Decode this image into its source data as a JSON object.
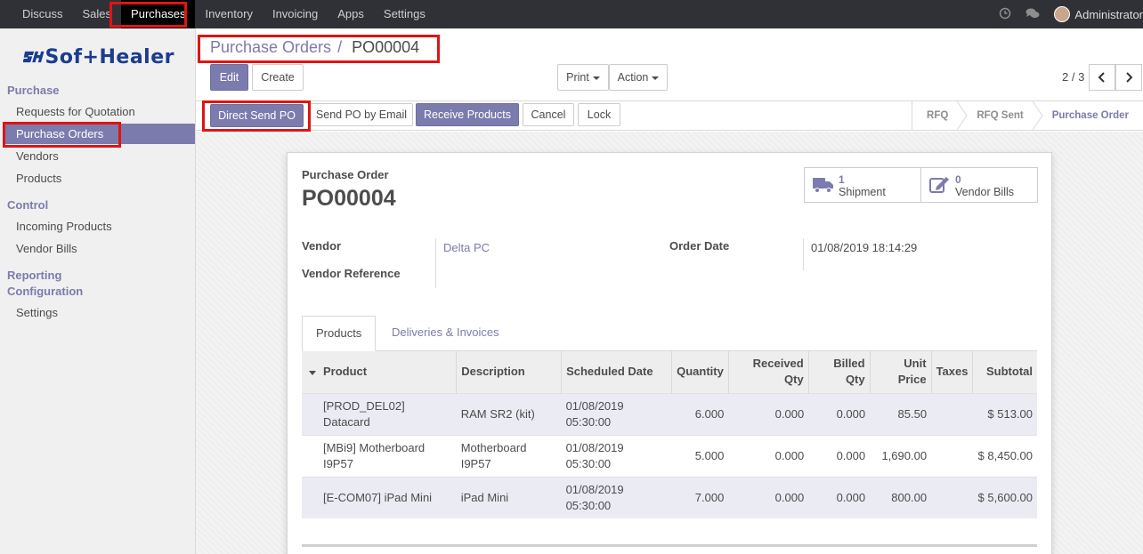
{
  "topbar": {
    "menu": [
      "Discuss",
      "Sales",
      "Purchases",
      "Inventory",
      "Invoicing",
      "Apps",
      "Settings"
    ],
    "active": "Purchases",
    "user": "Administrator"
  },
  "sidebar": {
    "logo_mark": "SH",
    "logo_text": "Sof+Healer",
    "sections": [
      {
        "title": "Purchase",
        "items": [
          "Requests for Quotation",
          "Purchase Orders",
          "Vendors",
          "Products"
        ]
      },
      {
        "title": "Control",
        "items": [
          "Incoming Products",
          "Vendor Bills"
        ]
      },
      {
        "title": "Reporting",
        "items": []
      },
      {
        "title": "Configuration",
        "items": [
          "Settings"
        ]
      }
    ],
    "active_item": "Purchase Orders"
  },
  "breadcrumb": {
    "parent": "Purchase Orders",
    "separator": "/",
    "current": "PO00004"
  },
  "buttons": {
    "edit": "Edit",
    "create": "Create",
    "print": "Print",
    "action": "Action"
  },
  "pager": {
    "value": "2 / 3"
  },
  "status_buttons": {
    "direct_send": "Direct Send PO",
    "send_email": "Send PO by Email",
    "receive": "Receive Products",
    "cancel": "Cancel",
    "lock": "Lock"
  },
  "stages": [
    "RFQ",
    "RFQ Sent",
    "Purchase Order"
  ],
  "current_stage": "Purchase Order",
  "form": {
    "label": "Purchase Order",
    "name": "PO00004",
    "smart_buttons": [
      {
        "count": "1",
        "label": "Shipment",
        "icon": "truck-icon"
      },
      {
        "count": "0",
        "label": "Vendor Bills",
        "icon": "pencil-square-icon"
      }
    ],
    "vendor_label": "Vendor",
    "vendor": "Delta PC",
    "vendor_ref_label": "Vendor Reference",
    "vendor_ref": "",
    "order_date_label": "Order Date",
    "order_date": "01/08/2019 18:14:29",
    "tabs": [
      "Products",
      "Deliveries & Invoices"
    ],
    "active_tab": "Products",
    "columns": [
      "Product",
      "Description",
      "Scheduled Date",
      "Quantity",
      "Received Qty",
      "Billed Qty",
      "Unit Price",
      "Taxes",
      "Subtotal"
    ],
    "lines": [
      {
        "product": "[PROD_DEL02] Datacard",
        "description": "RAM SR2 (kit)",
        "date": "01/08/2019 05:30:00",
        "qty": "6.000",
        "received": "0.000",
        "billed": "0.000",
        "price": "85.50",
        "taxes": "",
        "subtotal": "$ 513.00"
      },
      {
        "product": "[MBi9] Motherboard I9P57",
        "description": "Motherboard I9P57",
        "date": "01/08/2019 05:30:00",
        "qty": "5.000",
        "received": "0.000",
        "billed": "0.000",
        "price": "1,690.00",
        "taxes": "",
        "subtotal": "$ 8,450.00"
      },
      {
        "product": "[E-COM07] iPad Mini",
        "description": "iPad Mini",
        "date": "01/08/2019 05:30:00",
        "qty": "7.000",
        "received": "0.000",
        "billed": "0.000",
        "price": "800.00",
        "taxes": "",
        "subtotal": "$ 5,600.00"
      }
    ]
  },
  "colors": {
    "accent": "#7c7bad",
    "topbar": "#2f3136",
    "highlight": "#e01414"
  }
}
